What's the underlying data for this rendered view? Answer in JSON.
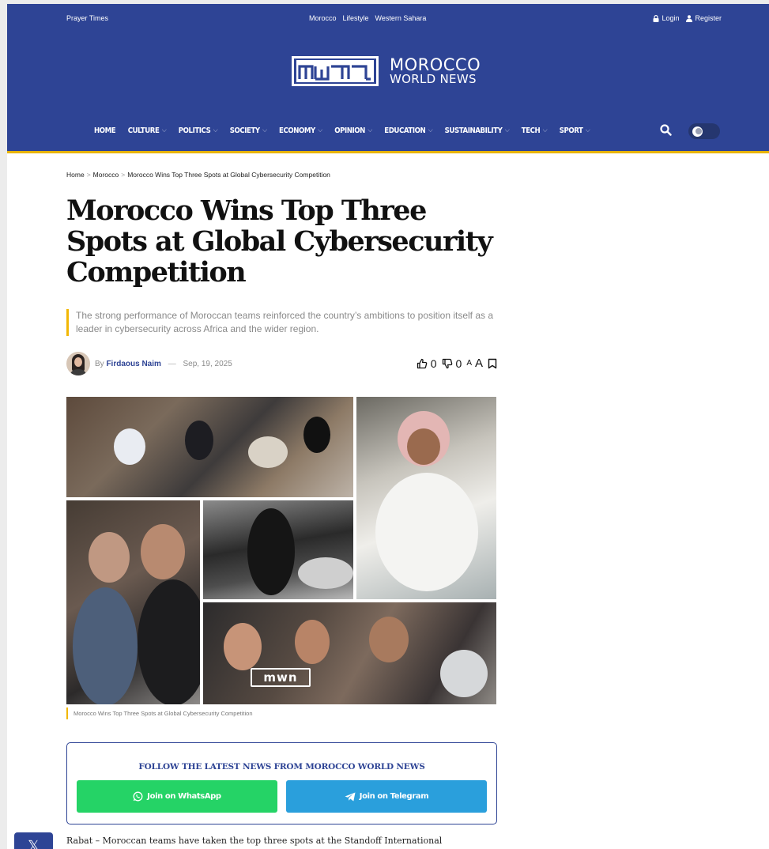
{
  "topbar": {
    "prayer": "Prayer Times",
    "center_links": [
      "Morocco",
      "Lifestyle",
      "Western Sahara"
    ],
    "login": "Login",
    "register": "Register"
  },
  "logo": {
    "mark": "mwn",
    "line1": "MOROCCO",
    "line2": "WORLD NEWS"
  },
  "nav": [
    {
      "label": "HOME",
      "dropdown": false
    },
    {
      "label": "CULTURE",
      "dropdown": true
    },
    {
      "label": "POLITICS",
      "dropdown": true
    },
    {
      "label": "SOCIETY",
      "dropdown": true
    },
    {
      "label": "ECONOMY",
      "dropdown": true
    },
    {
      "label": "OPINION",
      "dropdown": true
    },
    {
      "label": "EDUCATION",
      "dropdown": true
    },
    {
      "label": "SUSTAINABILITY",
      "dropdown": true
    },
    {
      "label": "TECH",
      "dropdown": true
    },
    {
      "label": "SPORT",
      "dropdown": true
    }
  ],
  "breadcrumb": {
    "home": "Home",
    "section": "Morocco",
    "current": "Morocco Wins Top Three Spots at Global Cybersecurity Competition",
    "sep": ">"
  },
  "article": {
    "title": "Morocco Wins Top Three Spots at Global Cybersecurity Competition",
    "subtitle": "The strong performance of Moroccan teams reinforced the country’s ambitions to position itself as a leader in cybersecurity across Africa and the wider region.",
    "by": "By",
    "author": "Firdaous Naim",
    "dash": "—",
    "date": "Sep, 19, 2025",
    "likes": "0",
    "dislikes": "0",
    "font_size_label_small": "A",
    "font_size_label_big": "A",
    "image_watermark": "mwn",
    "caption": "Morocco Wins Top Three Spots at Global Cybersecurity Competition",
    "lead": "Rabat – Moroccan teams have taken the top three spots at the Standoff International"
  },
  "follow": {
    "title": "FOLLOW THE LATEST NEWS FROM MOROCCO WORLD NEWS",
    "whatsapp": "Join on WhatsApp",
    "telegram": "Join on Telegram"
  },
  "share": {
    "x_label": "𝕏"
  },
  "colors": {
    "brand": "#2e4495",
    "accent": "#e8b400",
    "whatsapp": "#25d366",
    "telegram": "#2a9fdc"
  }
}
